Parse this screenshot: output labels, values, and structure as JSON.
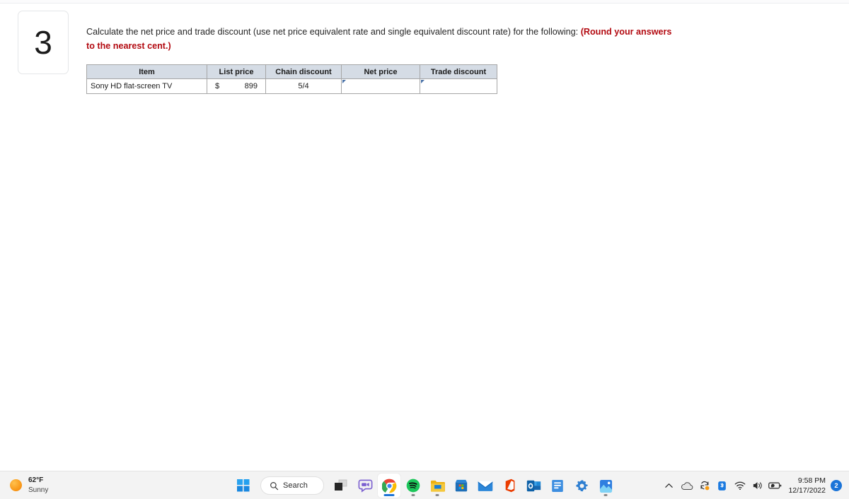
{
  "question": {
    "number": "3",
    "prompt_plain": "Calculate the net price and trade discount (use net price equivalent rate and single equivalent discount rate) for the following: ",
    "prompt_red": "(Round your answers to the nearest cent.)"
  },
  "table": {
    "headers": [
      "Item",
      "List price",
      "Chain discount",
      "Net price",
      "Trade discount"
    ],
    "rows": [
      {
        "item": "Sony HD flat-screen TV",
        "list_price_symbol": "$",
        "list_price_value": "899",
        "chain_discount": "5/4",
        "net_price": "",
        "trade_discount": ""
      }
    ],
    "header_bg": "#d5dce5",
    "answer_border": "#4a72a8"
  },
  "taskbar": {
    "weather": {
      "temperature": "62°F",
      "condition": "Sunny",
      "icon": "sun-icon"
    },
    "search": {
      "label": "Search",
      "icon": "search-icon"
    },
    "apps": [
      {
        "name": "start-button",
        "icon": "windows-logo-icon",
        "label": "Start",
        "active": false,
        "running": false
      },
      {
        "name": "task-view",
        "icon": "task-view-icon",
        "label": "Task View",
        "active": false,
        "running": false
      },
      {
        "name": "teams-chat",
        "icon": "chat-bubble-icon",
        "label": "Chat",
        "active": false,
        "running": false
      },
      {
        "name": "google-chrome",
        "icon": "chrome-icon",
        "label": "Google Chrome",
        "active": true,
        "running": true
      },
      {
        "name": "spotify",
        "icon": "spotify-icon",
        "label": "Spotify",
        "active": false,
        "running": true
      },
      {
        "name": "file-explorer",
        "icon": "folder-icon",
        "label": "File Explorer",
        "active": false,
        "running": true
      },
      {
        "name": "microsoft-store",
        "icon": "store-icon",
        "label": "Microsoft Store",
        "active": false,
        "running": false
      },
      {
        "name": "mail",
        "icon": "mail-icon",
        "label": "Mail",
        "active": false,
        "running": false
      },
      {
        "name": "microsoft-office",
        "icon": "office-icon",
        "label": "Microsoft Office",
        "active": false,
        "running": false
      },
      {
        "name": "outlook",
        "icon": "outlook-icon",
        "label": "Outlook",
        "active": false,
        "running": false
      },
      {
        "name": "word-document",
        "icon": "document-icon",
        "label": "Word",
        "active": false,
        "running": false
      },
      {
        "name": "settings",
        "icon": "gear-icon",
        "label": "Settings",
        "active": false,
        "running": true
      },
      {
        "name": "photos",
        "icon": "photos-icon",
        "label": "Photos",
        "active": false,
        "running": true
      }
    ],
    "tray": {
      "icons": [
        {
          "name": "show-hidden-icons",
          "icon": "chevron-up-icon"
        },
        {
          "name": "onedrive",
          "icon": "cloud-icon"
        },
        {
          "name": "windows-update",
          "icon": "update-sync-icon"
        },
        {
          "name": "bluetooth",
          "icon": "bluetooth-icon"
        },
        {
          "name": "network",
          "icon": "wifi-icon"
        },
        {
          "name": "volume",
          "icon": "speaker-icon"
        },
        {
          "name": "battery",
          "icon": "battery-icon"
        }
      ],
      "time": "9:58 PM",
      "date": "12/17/2022",
      "notification_count": "2"
    }
  }
}
